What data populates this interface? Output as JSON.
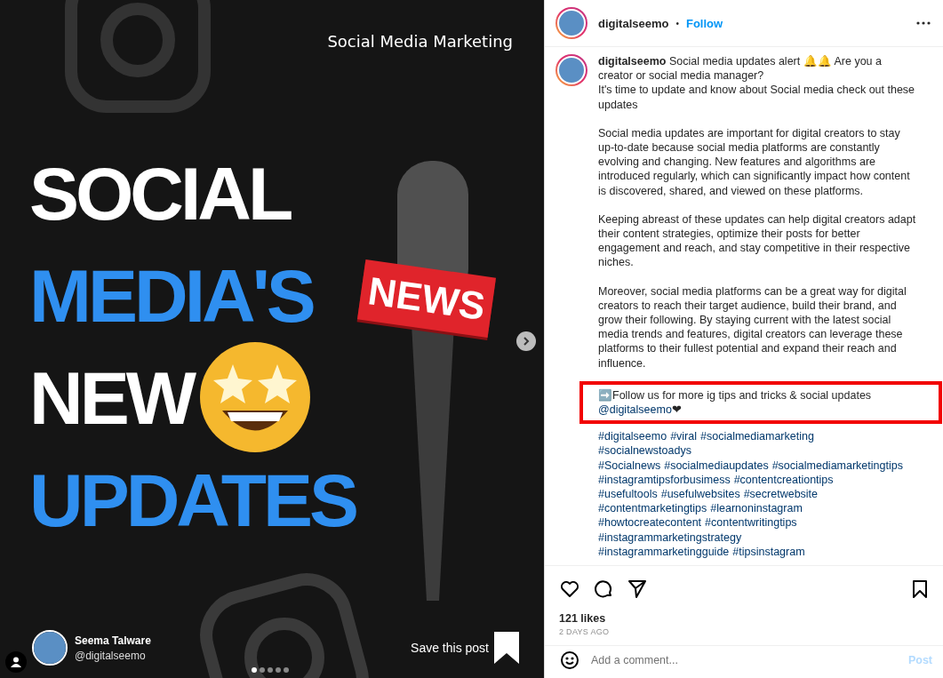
{
  "post_image": {
    "tag": "Social Media Marketing",
    "headline": [
      {
        "text": "SOCIAL",
        "color": "#ffffff"
      },
      {
        "text": "MEDIA'S",
        "color": "#2f8ff0"
      },
      {
        "text": "NEW",
        "color": "#ffffff"
      },
      {
        "text": "UPDATES",
        "color": "#2f8ff0"
      }
    ],
    "sign": "NEWS",
    "author_name": "Seema Talware",
    "author_handle": "@digitalseemo",
    "save_text": "Save this post",
    "dots": [
      {
        "selected": true
      },
      {
        "selected": false
      },
      {
        "selected": false
      },
      {
        "selected": false
      },
      {
        "selected": false
      }
    ]
  },
  "header": {
    "username": "digitalseemo",
    "separator": "•",
    "follow": "Follow"
  },
  "caption": {
    "username": "digitalseemo",
    "intro": "Social media updates alert 🔔🔔 Are you a creator or social media manager?",
    "line2": "It's time to update and know about Social media check out these updates",
    "paragraphs": [
      "Social media updates are important for digital creators to stay up-to-date because social media platforms are constantly evolving and changing. New features and algorithms are introduced regularly, which can significantly impact how content is discovered, shared, and viewed on these platforms.",
      "Keeping abreast of these updates can help digital creators adapt their content strategies, optimize their posts for better engagement and reach, and stay competitive in their respective niches.",
      "Moreover, social media platforms can be a great way for digital creators to reach their target audience, build their brand, and grow their following. By staying current with the latest social media trends and features, digital creators can leverage these platforms to their fullest potential and expand their reach and influence."
    ],
    "callout": {
      "text": "➡️Follow us for more ig tips and tricks & social updates",
      "mention": "@digitalseemo",
      "heart": "❤",
      "highlighted": true
    },
    "hashtag_lines": [
      [
        "#digitalseemo",
        "#viral",
        "#socialmediamarketing"
      ],
      [
        "#socialnewstoadys"
      ],
      [
        "#Socialnews",
        "#socialmediaupdates",
        "#socialmediamarketingtips"
      ],
      [
        "#instagramtipsforbusimess",
        "#contentcreationtips"
      ],
      [
        "#usefultools",
        "#usefulwebsites",
        "#secretwebsite"
      ],
      [
        "#contentmarketingtips",
        "#learnoninstagram"
      ],
      [
        "#howtocreatecontent",
        "#contentwritingtips"
      ],
      [
        "#instagrammarketingstrategy"
      ],
      [
        "#instagrammarketingguide",
        "#tipsinstagram"
      ]
    ]
  },
  "likes": "121 likes",
  "time": "2 DAYS AGO",
  "comment": {
    "placeholder": "Add a comment...",
    "post": "Post",
    "post_disabled": true
  }
}
